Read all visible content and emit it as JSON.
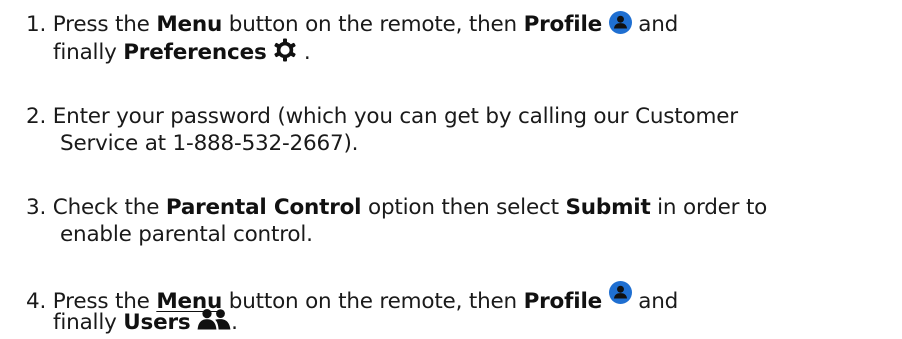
{
  "steps": [
    {
      "number": "1.",
      "line1": {
        "t1": "Press the ",
        "b1": "Menu",
        "t2": " button on the remote, then ",
        "b2": "Profile",
        "t3": " and"
      },
      "line2": {
        "t1": "finally ",
        "b1": "Preferences",
        "t2": " ."
      }
    },
    {
      "number": "2.",
      "line1": {
        "t1": "Enter your password (which you can get by calling our Customer"
      },
      "line2": {
        "t1": "Service at 1-888-532-2667)."
      }
    },
    {
      "number": "3.",
      "line1": {
        "t1": "Check the ",
        "b1": "Parental Control",
        "t2": " option then select ",
        "b2": "Submit",
        "t3": " in order to"
      },
      "line2": {
        "t1": "enable parental control."
      }
    },
    {
      "number": "4.",
      "line1": {
        "t1": "Press the ",
        "b1": "Menu",
        "t2": " button on the remote, then ",
        "b2": "Profile",
        "t3": " and"
      },
      "line2": {
        "t1": "finally ",
        "b1": "Users",
        "t2": "."
      }
    }
  ],
  "icons": {
    "profile": "profile-icon",
    "preferences": "gear-icon",
    "users": "users-icon"
  },
  "colors": {
    "profile_icon_bg": "#1f6fd1",
    "icon_dark": "#111111",
    "text": "#1a1a1a"
  }
}
